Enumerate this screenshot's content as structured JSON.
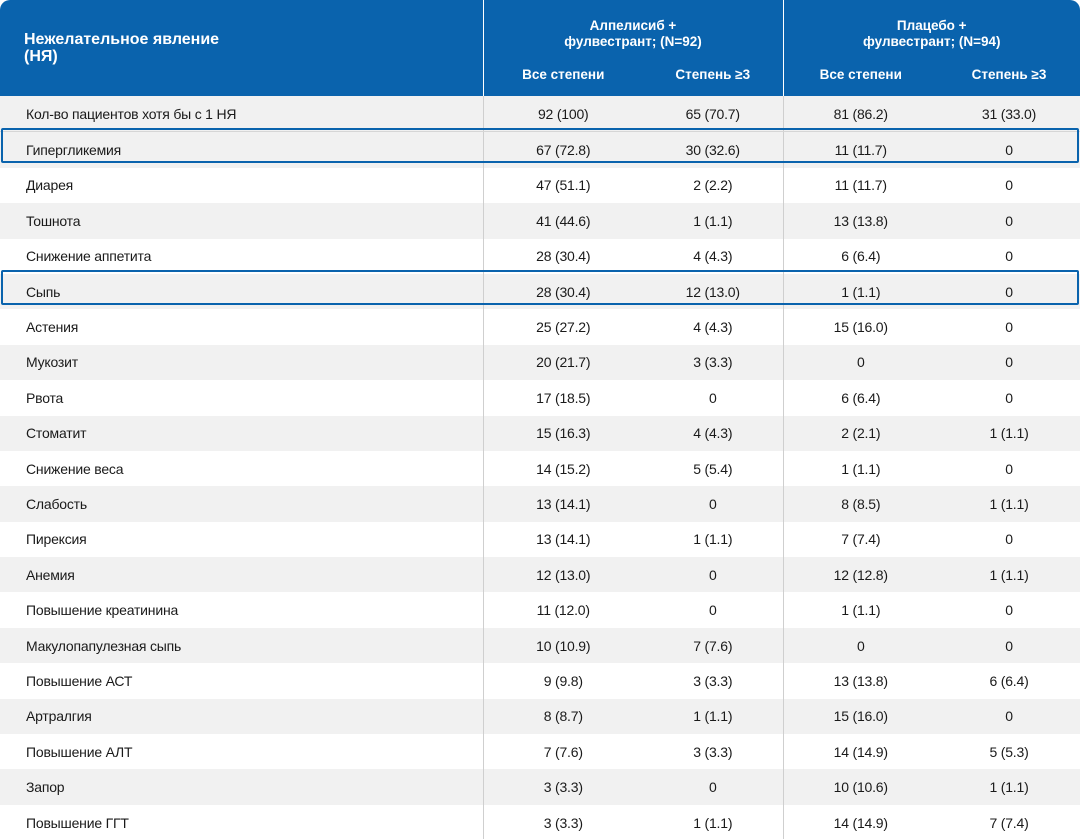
{
  "header": {
    "ae_title": "Нежелательное явление (НЯ)",
    "group_a": "Алпелисиб + фулвестрант; (N=92)",
    "group_b": "Плацебо + фулвестрант; (N=94)",
    "sub_all": "Все степени",
    "sub_grade3": "Степень ≥3"
  },
  "colors": {
    "header_bg": "#0a63ad",
    "highlight_border": "#0a63ad",
    "row_alt": "#f1f1f1"
  },
  "rows": [
    {
      "name": "Кол-во пациентов хотя бы с 1 НЯ",
      "a_all": "92 (100)",
      "a_g3": "65 (70.7)",
      "b_all": "81 (86.2)",
      "b_g3": "31 (33.0)"
    },
    {
      "name": "Гипергликемия",
      "a_all": "67 (72.8)",
      "a_g3": "30 (32.6)",
      "b_all": "11 (11.7)",
      "b_g3": "0",
      "highlighted": true
    },
    {
      "name": "Диарея",
      "a_all": "47 (51.1)",
      "a_g3": "2 (2.2)",
      "b_all": "11 (11.7)",
      "b_g3": "0"
    },
    {
      "name": "Тошнота",
      "a_all": "41 (44.6)",
      "a_g3": "1 (1.1)",
      "b_all": "13 (13.8)",
      "b_g3": "0"
    },
    {
      "name": "Снижение аппетита",
      "a_all": "28 (30.4)",
      "a_g3": "4 (4.3)",
      "b_all": "6 (6.4)",
      "b_g3": "0"
    },
    {
      "name": "Сыпь",
      "a_all": "28 (30.4)",
      "a_g3": "12 (13.0)",
      "b_all": "1 (1.1)",
      "b_g3": "0",
      "highlighted": true
    },
    {
      "name": "Астения",
      "a_all": "25 (27.2)",
      "a_g3": "4 (4.3)",
      "b_all": "15 (16.0)",
      "b_g3": "0"
    },
    {
      "name": "Мукозит",
      "a_all": "20 (21.7)",
      "a_g3": "3 (3.3)",
      "b_all": "0",
      "b_g3": "0"
    },
    {
      "name": "Рвота",
      "a_all": "17 (18.5)",
      "a_g3": "0",
      "b_all": "6 (6.4)",
      "b_g3": "0"
    },
    {
      "name": "Стоматит",
      "a_all": "15 (16.3)",
      "a_g3": "4 (4.3)",
      "b_all": "2 (2.1)",
      "b_g3": "1 (1.1)"
    },
    {
      "name": "Снижение веса",
      "a_all": "14 (15.2)",
      "a_g3": "5 (5.4)",
      "b_all": "1 (1.1)",
      "b_g3": "0"
    },
    {
      "name": "Слабость",
      "a_all": "13 (14.1)",
      "a_g3": "0",
      "b_all": "8 (8.5)",
      "b_g3": "1 (1.1)"
    },
    {
      "name": "Пирексия",
      "a_all": "13 (14.1)",
      "a_g3": "1 (1.1)",
      "b_all": "7 (7.4)",
      "b_g3": "0"
    },
    {
      "name": "Анемия",
      "a_all": "12 (13.0)",
      "a_g3": "0",
      "b_all": "12 (12.8)",
      "b_g3": "1 (1.1)"
    },
    {
      "name": "Повышение креатинина",
      "a_all": "11 (12.0)",
      "a_g3": "0",
      "b_all": "1 (1.1)",
      "b_g3": "0"
    },
    {
      "name": "Макулопапулезная сыпь",
      "a_all": "10 (10.9)",
      "a_g3": "7 (7.6)",
      "b_all": "0",
      "b_g3": "0"
    },
    {
      "name": "Повышение АСТ",
      "a_all": "9 (9.8)",
      "a_g3": "3 (3.3)",
      "b_all": "13 (13.8)",
      "b_g3": "6 (6.4)"
    },
    {
      "name": "Артралгия",
      "a_all": "8 (8.7)",
      "a_g3": "1 (1.1)",
      "b_all": "15 (16.0)",
      "b_g3": "0"
    },
    {
      "name": "Повышение АЛТ",
      "a_all": "7 (7.6)",
      "a_g3": "3 (3.3)",
      "b_all": "14 (14.9)",
      "b_g3": "5 (5.3)"
    },
    {
      "name": "Запор",
      "a_all": "3 (3.3)",
      "a_g3": "0",
      "b_all": "10 (10.6)",
      "b_g3": "1 (1.1)"
    },
    {
      "name": "Повышение ГГТ",
      "a_all": "3 (3.3)",
      "a_g3": "1 (1.1)",
      "b_all": "14 (14.9)",
      "b_g3": "7 (7.4)"
    }
  ]
}
